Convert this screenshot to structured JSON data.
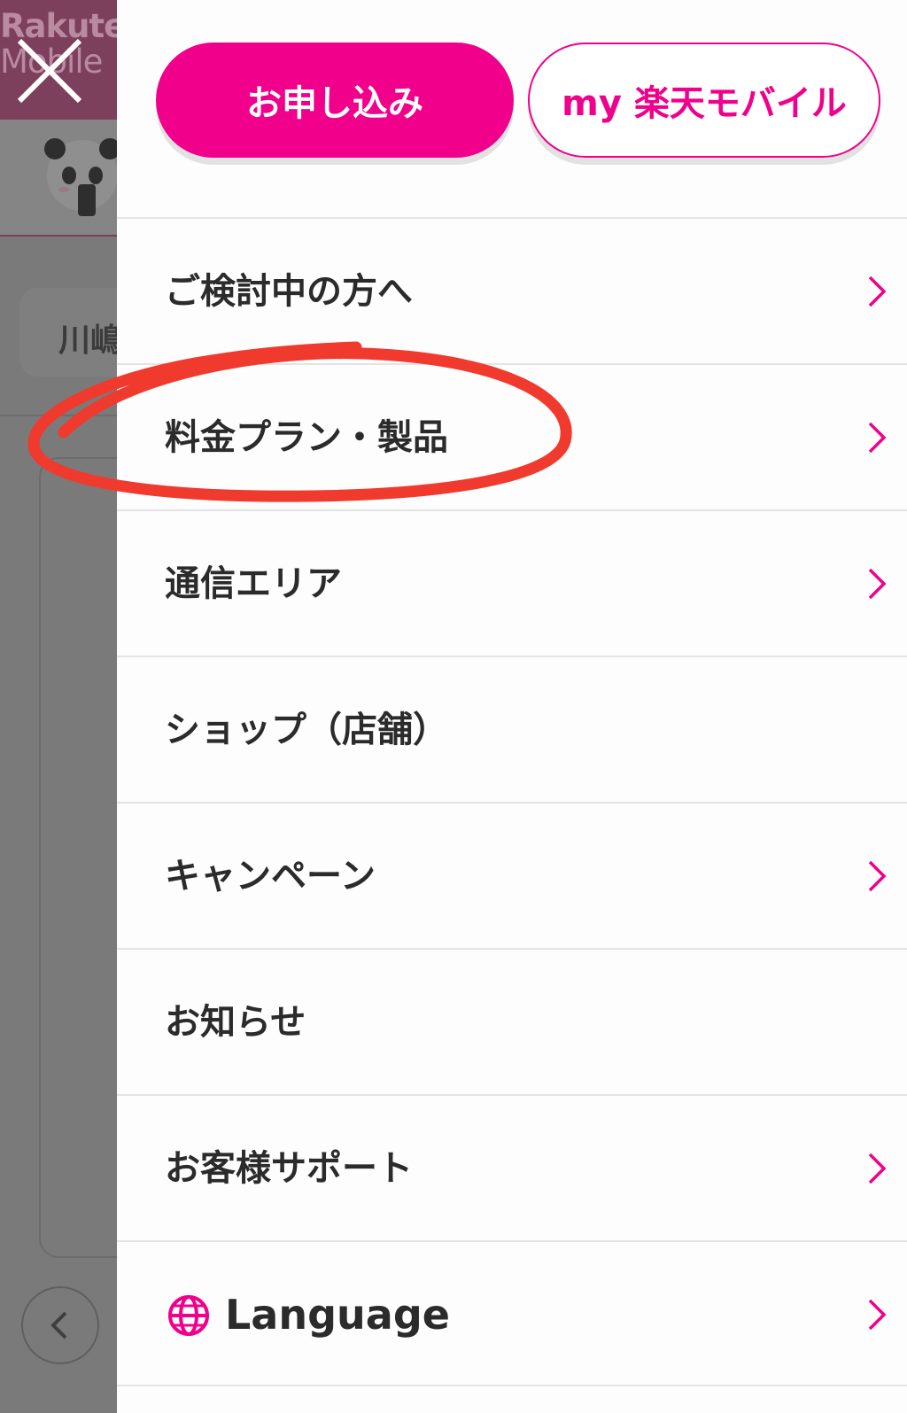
{
  "background_page": {
    "logo_line1": "Rakute",
    "logo_line2": "Mobile",
    "search_text": "川嶋"
  },
  "drawer": {
    "apply_button": "お申し込み",
    "my_button": "my 楽天モバイル",
    "menu_items": [
      {
        "label": "ご検討中の方へ",
        "has_chevron": true
      },
      {
        "label": "料金プラン・製品",
        "has_chevron": true
      },
      {
        "label": "通信エリア",
        "has_chevron": true
      },
      {
        "label": "ショップ（店舗）",
        "has_chevron": false
      },
      {
        "label": "キャンペーン",
        "has_chevron": true
      },
      {
        "label": "お知らせ",
        "has_chevron": false
      },
      {
        "label": "お客様サポート",
        "has_chevron": true
      },
      {
        "label": "Language",
        "has_chevron": true,
        "icon": "globe-icon"
      }
    ]
  },
  "colors": {
    "accent": "#f0008b",
    "annotation": "#f03a2e",
    "overlay": "#7a7a7a"
  }
}
